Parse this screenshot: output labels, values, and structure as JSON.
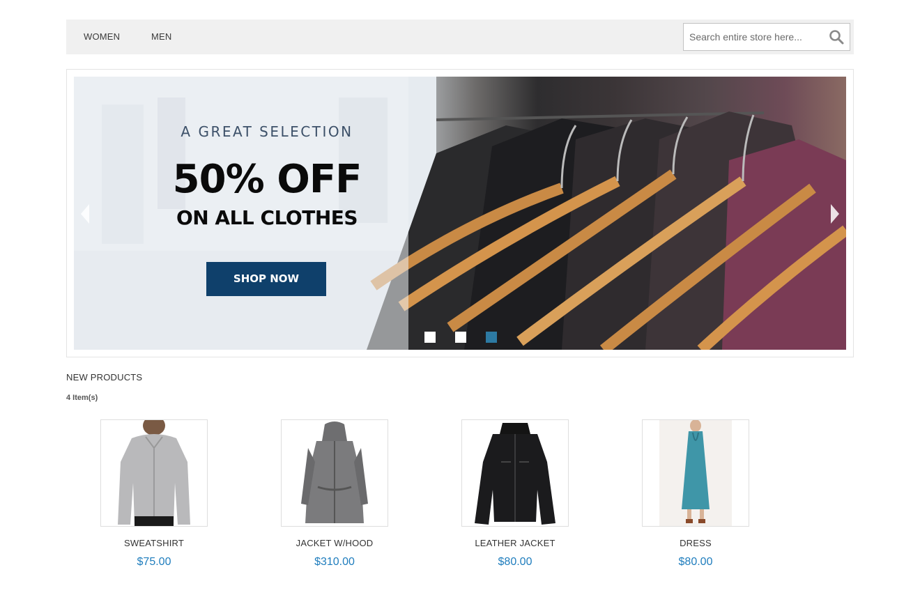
{
  "nav": {
    "items": [
      {
        "label": "WOMEN"
      },
      {
        "label": "MEN"
      }
    ]
  },
  "search": {
    "placeholder": "Search entire store here...",
    "value": "",
    "icon": "search-icon"
  },
  "hero": {
    "kicker": "A GREAT SELECTION",
    "headline": "50% OFF",
    "subline": "ON ALL CLOTHES",
    "cta_label": "SHOP NOW",
    "prev_icon": "chevron-left-icon",
    "next_icon": "chevron-right-icon",
    "slide_count": 3,
    "active_slide": 3,
    "colors": {
      "cta_bg": "#0f406b",
      "dot_active": "#2d7aa3",
      "dot_inactive": "#ffffff"
    }
  },
  "products": {
    "section_title": "NEW PRODUCTS",
    "count_label": "4 Item(s)",
    "price_color": "#1f7dbd",
    "items": [
      {
        "name": "SWEATSHIRT",
        "price": "$75.00"
      },
      {
        "name": "JACKET W/HOOD",
        "price": "$310.00"
      },
      {
        "name": "LEATHER JACKET",
        "price": "$80.00"
      },
      {
        "name": "DRESS",
        "price": "$80.00"
      }
    ]
  }
}
